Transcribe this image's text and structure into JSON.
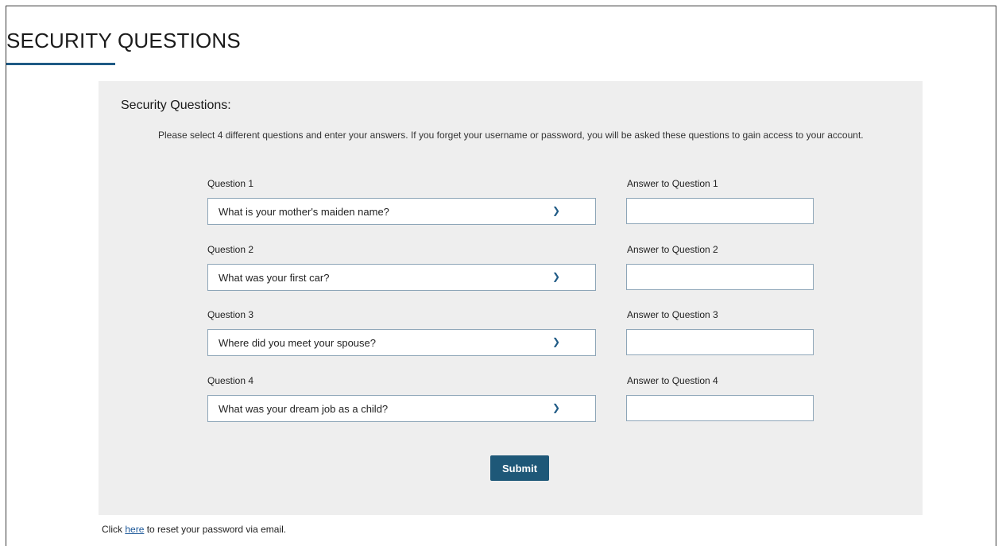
{
  "page": {
    "title": "SECURITY QUESTIONS"
  },
  "form": {
    "heading": "Security Questions:",
    "instructions": "Please select 4 different questions and enter your answers. If you forget your username or password, you will be asked these questions to gain access to your account.",
    "questions": [
      {
        "label": "Question 1",
        "selected": "What is your mother's maiden name?",
        "answer_label": "Answer to Question 1",
        "answer_value": ""
      },
      {
        "label": "Question 2",
        "selected": "What was your first car?",
        "answer_label": "Answer to Question 2",
        "answer_value": ""
      },
      {
        "label": "Question 3",
        "selected": "Where did you meet your spouse?",
        "answer_label": "Answer to Question 3",
        "answer_value": ""
      },
      {
        "label": "Question 4",
        "selected": "What was your dream job as a child?",
        "answer_label": "Answer to Question 4",
        "answer_value": ""
      }
    ],
    "submit_label": "Submit",
    "dropdown_icon": "chevron-down-icon"
  },
  "footer": {
    "prefix": "Click ",
    "link_text": "here",
    "suffix": " to reset your password via email."
  },
  "colors": {
    "accent": "#1f5a85",
    "button": "#1e5878",
    "panel_bg": "#eeeeee",
    "link": "#1f5a9a"
  }
}
